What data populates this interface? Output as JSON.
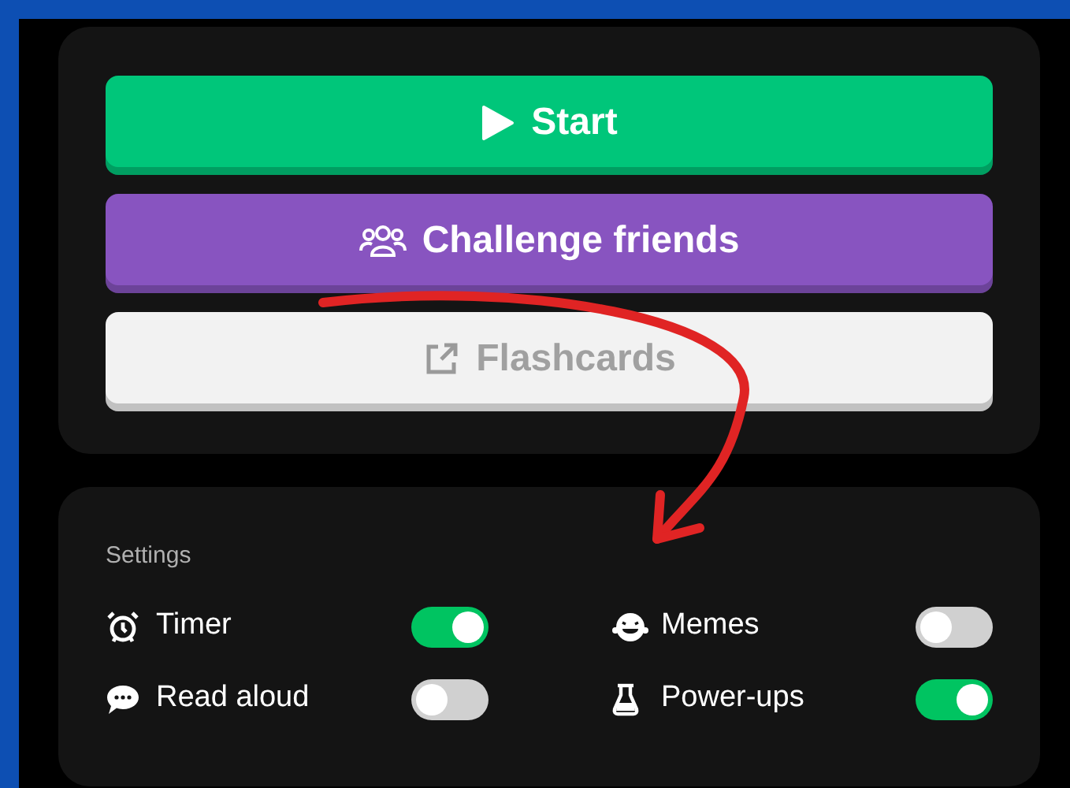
{
  "actions": [
    {
      "label": "Start",
      "kind": "play",
      "color": "#00c67a",
      "disabled": false
    },
    {
      "label": "Challenge friends",
      "kind": "group",
      "color": "#8854c0",
      "disabled": false
    },
    {
      "label": "Flashcards",
      "kind": "external",
      "color": "#f2f2f2",
      "disabled": true
    }
  ],
  "settings": {
    "title": "Settings",
    "items": [
      {
        "label": "Timer",
        "kind": "alarm",
        "on": true
      },
      {
        "label": "Memes",
        "kind": "laugh",
        "on": false
      },
      {
        "label": "Read aloud",
        "kind": "chat",
        "on": false
      },
      {
        "label": "Power-ups",
        "kind": "flask",
        "on": true
      }
    ]
  }
}
